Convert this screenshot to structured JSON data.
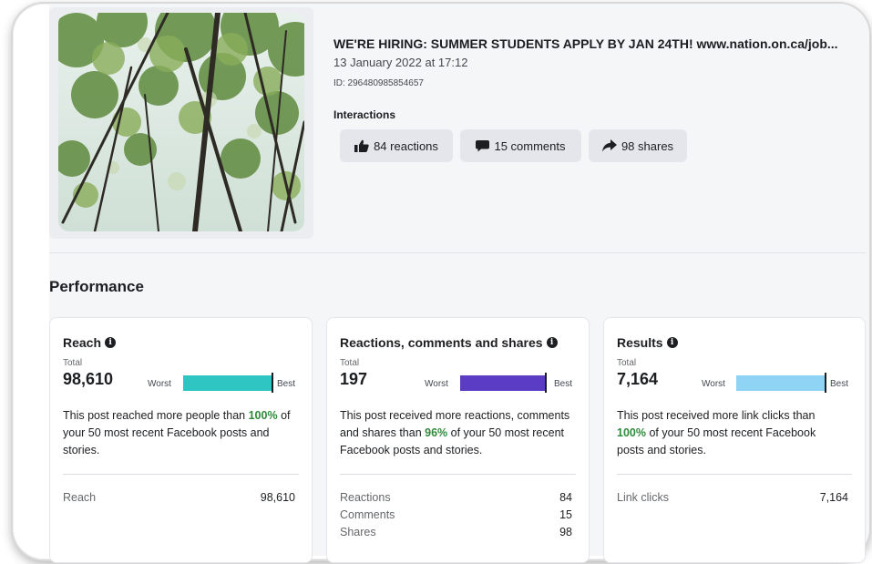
{
  "post": {
    "title": "WE'RE HIRING: SUMMER STUDENTS APPLY BY JAN 24TH! www.nation.on.ca/job...",
    "date": "13 January 2022 at 17:12",
    "id": "ID: 296480985854657",
    "interactions_label": "Interactions",
    "reactions_chip": "84 reactions",
    "comments_chip": "15 comments",
    "shares_chip": "98 shares"
  },
  "performance": {
    "title": "Performance",
    "cards": [
      {
        "title": "Reach",
        "total_label": "Total",
        "total_value": "98,610",
        "worst": "Worst",
        "best": "Best",
        "bar_color": "#2fc5c2",
        "bar_level": 1.0,
        "desc_prefix": "This post reached more people than ",
        "desc_pct": "100%",
        "desc_suffix": " of your 50 most recent Facebook posts and stories.",
        "metrics": [
          {
            "label": "Reach",
            "value": "98,610"
          }
        ]
      },
      {
        "title": "Reactions, comments and shares",
        "total_label": "Total",
        "total_value": "197",
        "worst": "Worst",
        "best": "Best",
        "bar_color": "#5b3cc4",
        "bar_level": 0.96,
        "desc_prefix": "This post received more reactions, comments and shares than ",
        "desc_pct": "96%",
        "desc_suffix": " of your 50 most recent Facebook posts and stories.",
        "metrics": [
          {
            "label": "Reactions",
            "value": "84"
          },
          {
            "label": "Comments",
            "value": "15"
          },
          {
            "label": "Shares",
            "value": "98"
          }
        ]
      },
      {
        "title": "Results",
        "total_label": "Total",
        "total_value": "7,164",
        "worst": "Worst",
        "best": "Best",
        "bar_color": "#8fd3f5",
        "bar_level": 1.0,
        "desc_prefix": "This post received more link clicks than ",
        "desc_pct": "100%",
        "desc_suffix": " of your 50 most recent Facebook posts and stories.",
        "metrics": [
          {
            "label": "Link clicks",
            "value": "7,164"
          }
        ]
      }
    ]
  },
  "icons": {
    "reactions": "thumbs-up-icon",
    "comments": "speech-bubble-icon",
    "shares": "share-arrow-icon",
    "info": "info-icon"
  }
}
